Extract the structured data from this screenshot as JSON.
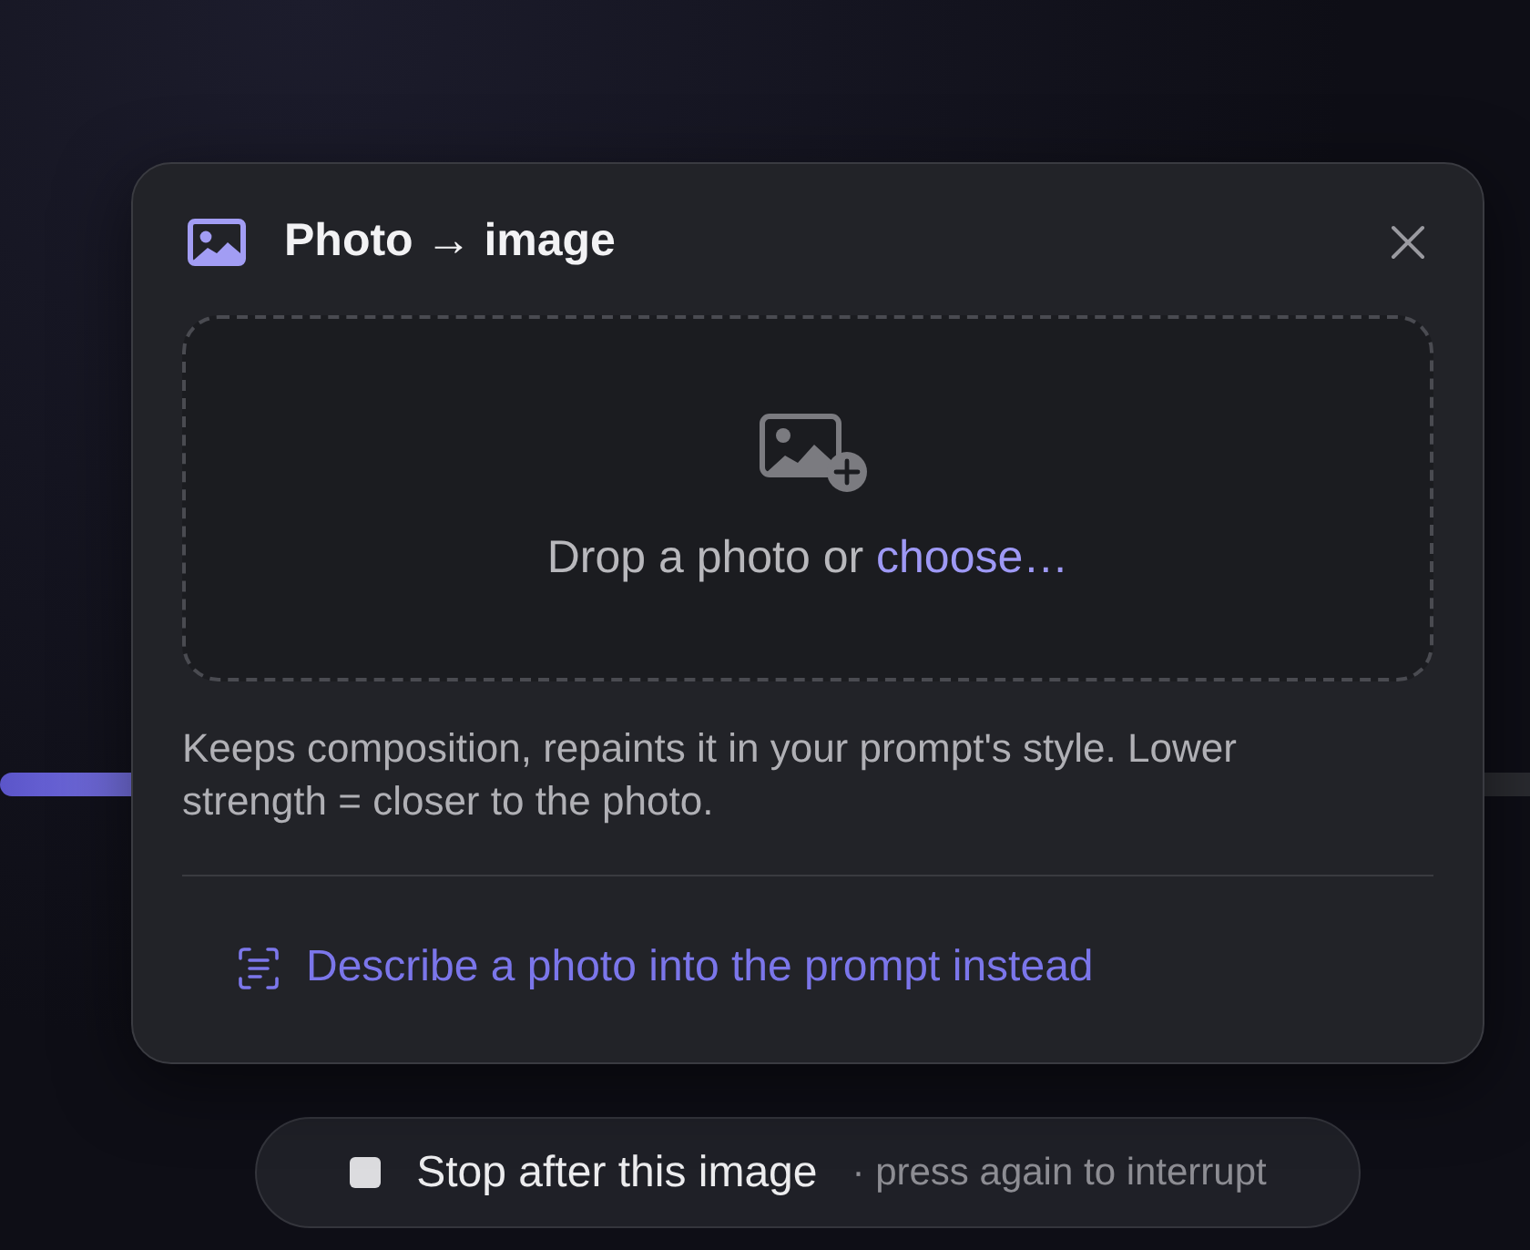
{
  "dialog": {
    "title": "Photo → image",
    "drop_zone": {
      "prompt": "Drop a photo or",
      "link": "choose…"
    },
    "description": "Keeps composition, repaints it in your prompt's style. Lower strength = closer to the photo.",
    "alt_action": "Describe a photo into the prompt instead"
  },
  "stop_button": {
    "label": "Stop after this image",
    "hint": "· press again to interrupt"
  }
}
